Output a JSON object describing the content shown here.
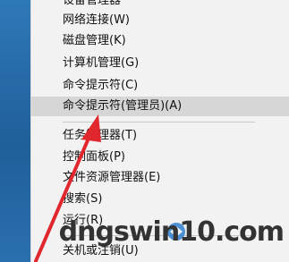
{
  "menu": {
    "items": [
      {
        "label": "设备管理器"
      },
      {
        "label": "网络连接(W)"
      },
      {
        "label": "磁盘管理(K)"
      },
      {
        "label": "计算机管理(G)"
      },
      {
        "label": "命令提示符(C)"
      },
      {
        "label": "命令提示符(管理员)(A)"
      },
      {
        "label": "任务管理器(T)"
      },
      {
        "label": "控制面板(P)"
      },
      {
        "label": "文件资源管理器(E)"
      },
      {
        "label": "搜索(S)"
      },
      {
        "label": "运行(R)"
      },
      {
        "label": "关机或注销(U)"
      }
    ]
  },
  "watermark": {
    "text": "dngswin10.com"
  },
  "colors": {
    "arrow": "#e0272e",
    "desktop": "#2a6fae",
    "highlight": "#d6d6d6"
  }
}
